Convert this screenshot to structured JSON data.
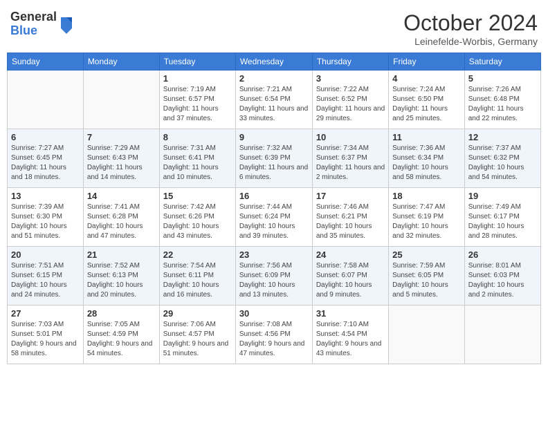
{
  "header": {
    "logo_general": "General",
    "logo_blue": "Blue",
    "month_title": "October 2024",
    "location": "Leinefelde-Worbis, Germany"
  },
  "weekdays": [
    "Sunday",
    "Monday",
    "Tuesday",
    "Wednesday",
    "Thursday",
    "Friday",
    "Saturday"
  ],
  "weeks": [
    [
      {
        "day": "",
        "info": ""
      },
      {
        "day": "",
        "info": ""
      },
      {
        "day": "1",
        "sunrise": "7:19 AM",
        "sunset": "6:57 PM",
        "daylight": "11 hours and 37 minutes."
      },
      {
        "day": "2",
        "sunrise": "7:21 AM",
        "sunset": "6:54 PM",
        "daylight": "11 hours and 33 minutes."
      },
      {
        "day": "3",
        "sunrise": "7:22 AM",
        "sunset": "6:52 PM",
        "daylight": "11 hours and 29 minutes."
      },
      {
        "day": "4",
        "sunrise": "7:24 AM",
        "sunset": "6:50 PM",
        "daylight": "11 hours and 25 minutes."
      },
      {
        "day": "5",
        "sunrise": "7:26 AM",
        "sunset": "6:48 PM",
        "daylight": "11 hours and 22 minutes."
      }
    ],
    [
      {
        "day": "6",
        "sunrise": "7:27 AM",
        "sunset": "6:45 PM",
        "daylight": "11 hours and 18 minutes."
      },
      {
        "day": "7",
        "sunrise": "7:29 AM",
        "sunset": "6:43 PM",
        "daylight": "11 hours and 14 minutes."
      },
      {
        "day": "8",
        "sunrise": "7:31 AM",
        "sunset": "6:41 PM",
        "daylight": "11 hours and 10 minutes."
      },
      {
        "day": "9",
        "sunrise": "7:32 AM",
        "sunset": "6:39 PM",
        "daylight": "11 hours and 6 minutes."
      },
      {
        "day": "10",
        "sunrise": "7:34 AM",
        "sunset": "6:37 PM",
        "daylight": "11 hours and 2 minutes."
      },
      {
        "day": "11",
        "sunrise": "7:36 AM",
        "sunset": "6:34 PM",
        "daylight": "10 hours and 58 minutes."
      },
      {
        "day": "12",
        "sunrise": "7:37 AM",
        "sunset": "6:32 PM",
        "daylight": "10 hours and 54 minutes."
      }
    ],
    [
      {
        "day": "13",
        "sunrise": "7:39 AM",
        "sunset": "6:30 PM",
        "daylight": "10 hours and 51 minutes."
      },
      {
        "day": "14",
        "sunrise": "7:41 AM",
        "sunset": "6:28 PM",
        "daylight": "10 hours and 47 minutes."
      },
      {
        "day": "15",
        "sunrise": "7:42 AM",
        "sunset": "6:26 PM",
        "daylight": "10 hours and 43 minutes."
      },
      {
        "day": "16",
        "sunrise": "7:44 AM",
        "sunset": "6:24 PM",
        "daylight": "10 hours and 39 minutes."
      },
      {
        "day": "17",
        "sunrise": "7:46 AM",
        "sunset": "6:21 PM",
        "daylight": "10 hours and 35 minutes."
      },
      {
        "day": "18",
        "sunrise": "7:47 AM",
        "sunset": "6:19 PM",
        "daylight": "10 hours and 32 minutes."
      },
      {
        "day": "19",
        "sunrise": "7:49 AM",
        "sunset": "6:17 PM",
        "daylight": "10 hours and 28 minutes."
      }
    ],
    [
      {
        "day": "20",
        "sunrise": "7:51 AM",
        "sunset": "6:15 PM",
        "daylight": "10 hours and 24 minutes."
      },
      {
        "day": "21",
        "sunrise": "7:52 AM",
        "sunset": "6:13 PM",
        "daylight": "10 hours and 20 minutes."
      },
      {
        "day": "22",
        "sunrise": "7:54 AM",
        "sunset": "6:11 PM",
        "daylight": "10 hours and 16 minutes."
      },
      {
        "day": "23",
        "sunrise": "7:56 AM",
        "sunset": "6:09 PM",
        "daylight": "10 hours and 13 minutes."
      },
      {
        "day": "24",
        "sunrise": "7:58 AM",
        "sunset": "6:07 PM",
        "daylight": "10 hours and 9 minutes."
      },
      {
        "day": "25",
        "sunrise": "7:59 AM",
        "sunset": "6:05 PM",
        "daylight": "10 hours and 5 minutes."
      },
      {
        "day": "26",
        "sunrise": "8:01 AM",
        "sunset": "6:03 PM",
        "daylight": "10 hours and 2 minutes."
      }
    ],
    [
      {
        "day": "27",
        "sunrise": "7:03 AM",
        "sunset": "5:01 PM",
        "daylight": "9 hours and 58 minutes."
      },
      {
        "day": "28",
        "sunrise": "7:05 AM",
        "sunset": "4:59 PM",
        "daylight": "9 hours and 54 minutes."
      },
      {
        "day": "29",
        "sunrise": "7:06 AM",
        "sunset": "4:57 PM",
        "daylight": "9 hours and 51 minutes."
      },
      {
        "day": "30",
        "sunrise": "7:08 AM",
        "sunset": "4:56 PM",
        "daylight": "9 hours and 47 minutes."
      },
      {
        "day": "31",
        "sunrise": "7:10 AM",
        "sunset": "4:54 PM",
        "daylight": "9 hours and 43 minutes."
      },
      {
        "day": "",
        "info": ""
      },
      {
        "day": "",
        "info": ""
      }
    ]
  ],
  "labels": {
    "sunrise": "Sunrise:",
    "sunset": "Sunset:",
    "daylight": "Daylight:"
  }
}
